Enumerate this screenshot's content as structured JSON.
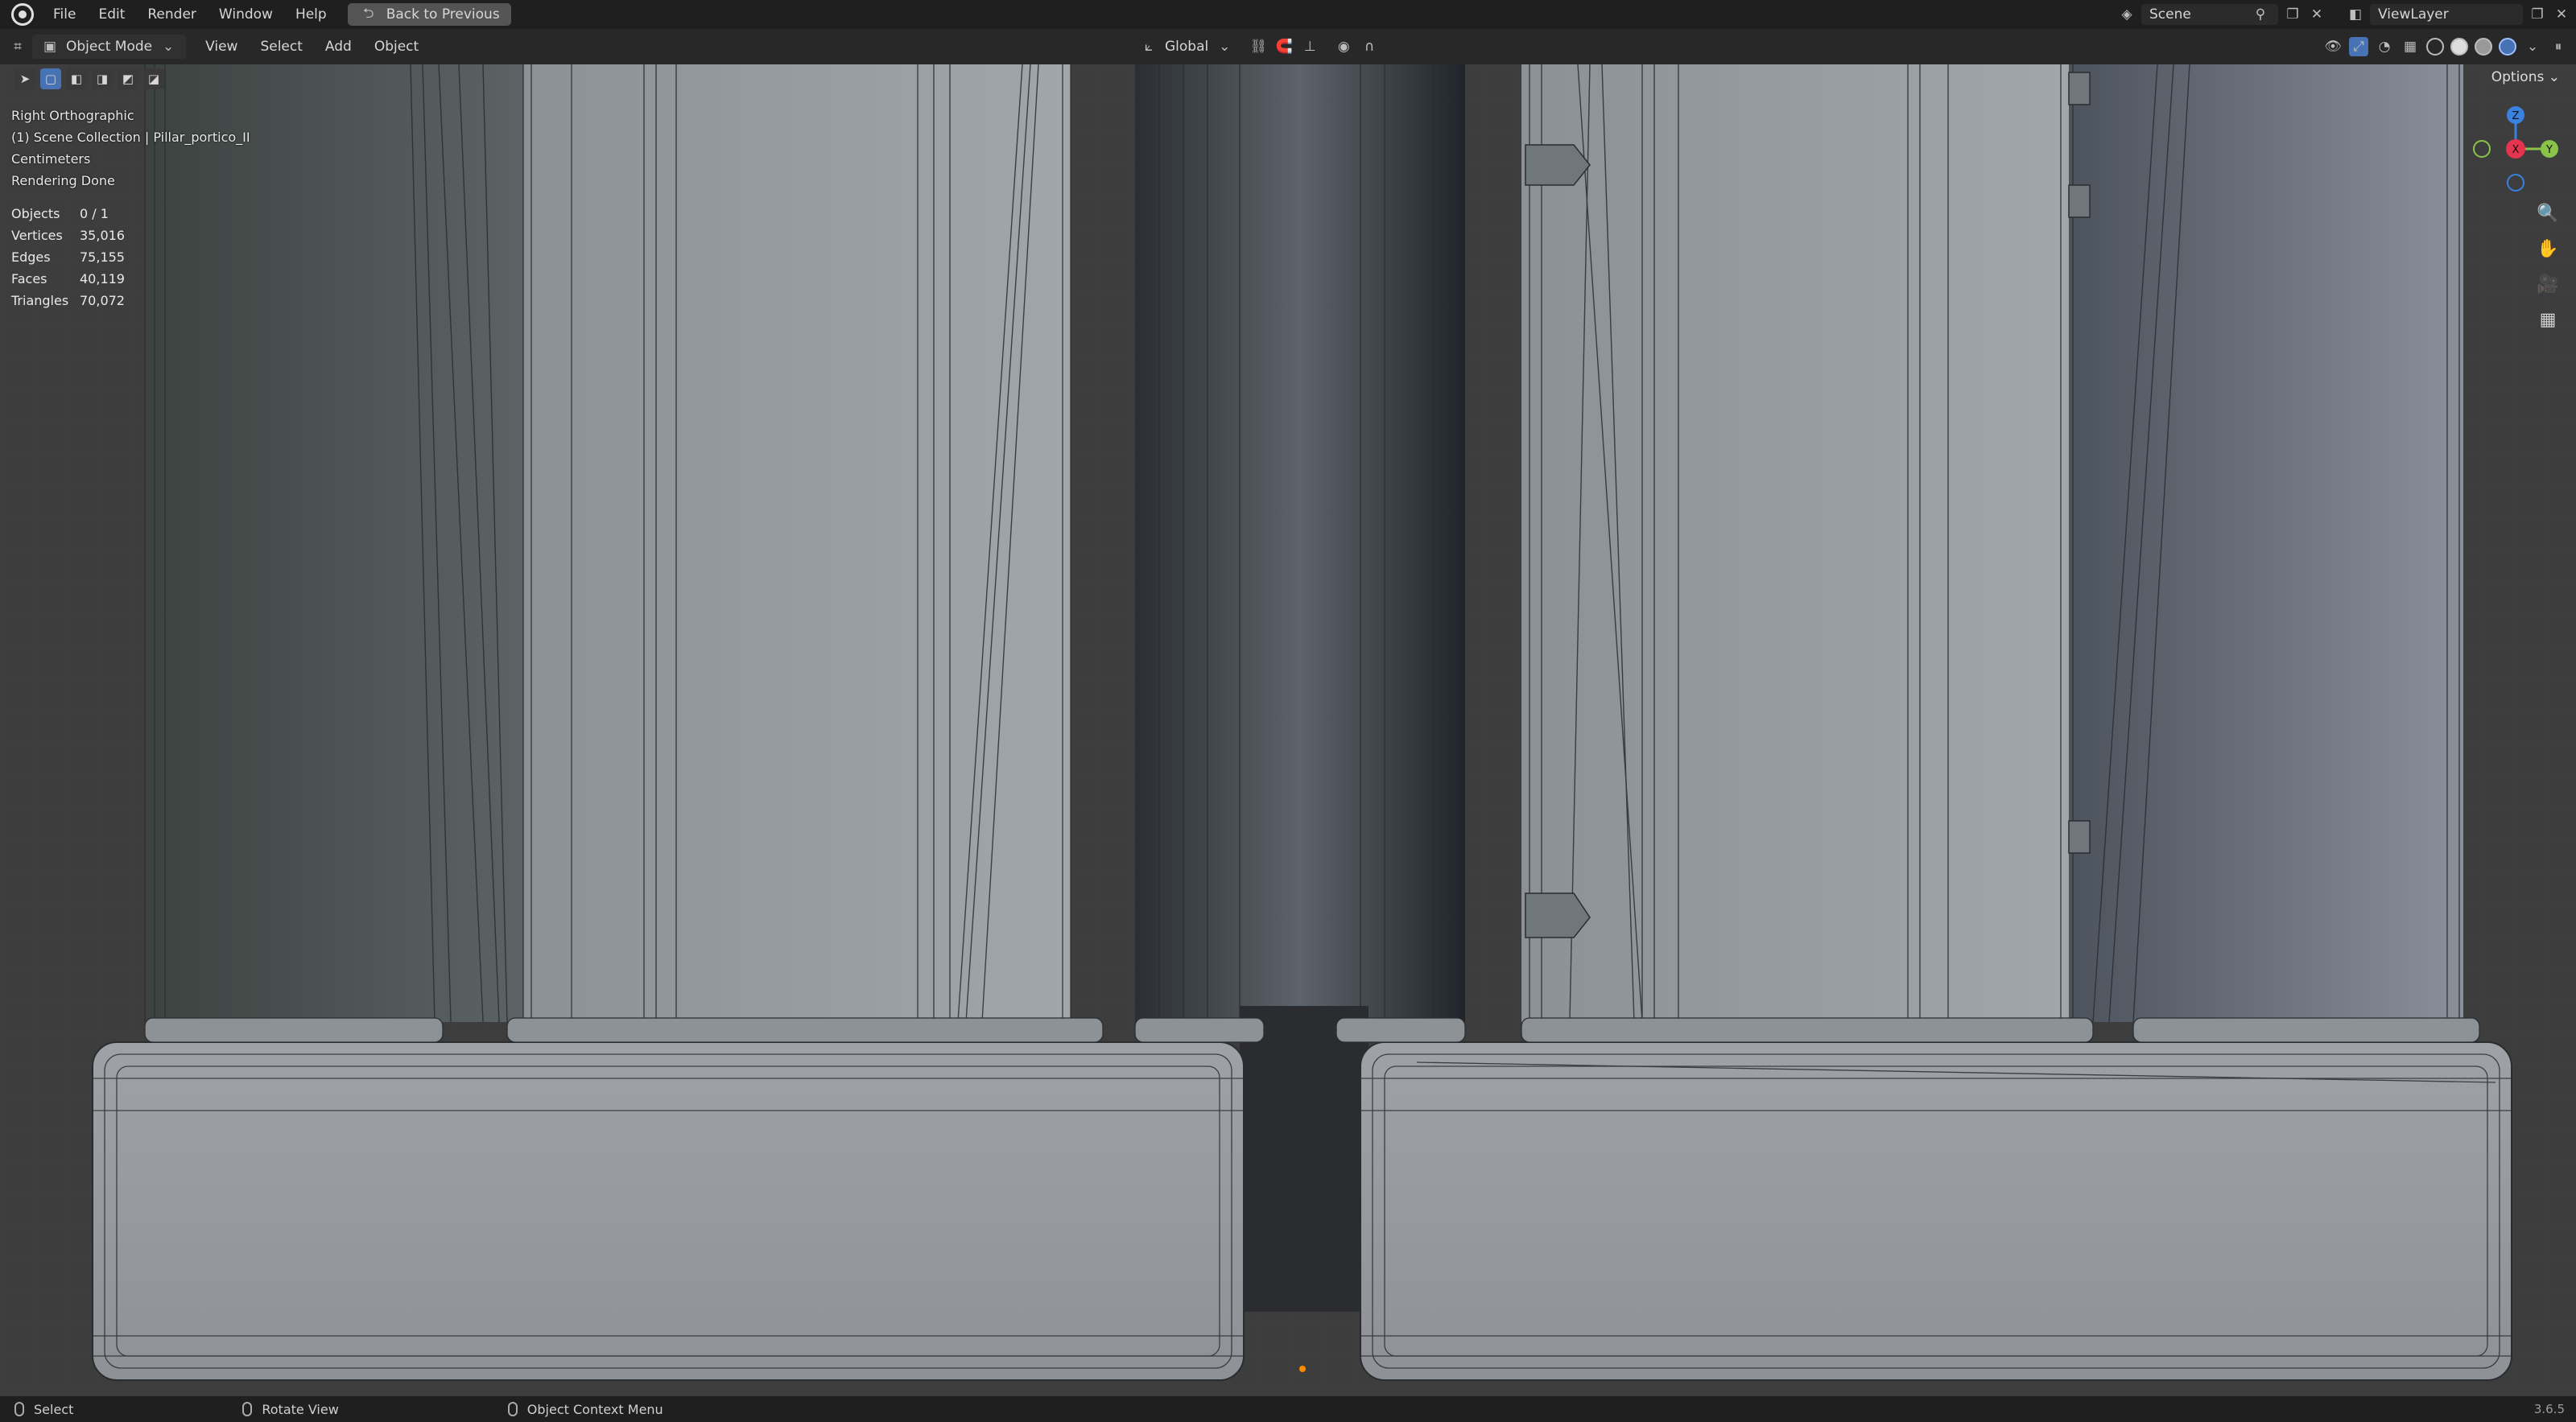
{
  "topbar": {
    "menus": [
      "File",
      "Edit",
      "Render",
      "Window",
      "Help"
    ],
    "back_button": "Back to Previous",
    "scene": "Scene",
    "view_layer": "ViewLayer"
  },
  "header": {
    "mode": "Object Mode",
    "menus": [
      "View",
      "Select",
      "Add",
      "Object"
    ],
    "transform_orientation": "Global",
    "options": "Options"
  },
  "viewport_info": {
    "view_name": "Right Orthographic",
    "collection": "(1) Scene Collection | Pillar_portico_II",
    "units": "Centimeters",
    "render_status": "Rendering Done"
  },
  "stats": [
    {
      "label": "Objects",
      "value": "0 / 1"
    },
    {
      "label": "Vertices",
      "value": "35,016"
    },
    {
      "label": "Edges",
      "value": "75,155"
    },
    {
      "label": "Faces",
      "value": "40,119"
    },
    {
      "label": "Triangles",
      "value": "70,072"
    }
  ],
  "gizmo": {
    "z": "Z",
    "x": "X",
    "y": "Y"
  },
  "statusbar": {
    "select": "Select",
    "rotate": "Rotate View",
    "context": "Object Context Menu",
    "version": "3.6.5"
  },
  "colors": {
    "accent": "#4772b3",
    "axis_x": "#e5344f",
    "axis_y": "#8bc34a",
    "axis_z": "#3b82e0"
  }
}
